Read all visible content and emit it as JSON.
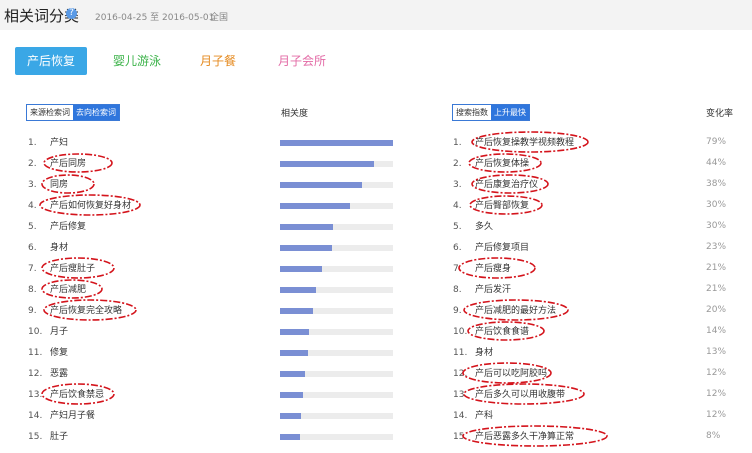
{
  "header": {
    "title": "相关词分类",
    "date_range": "2016-04-25 至 2016-05-01",
    "scope": "全国"
  },
  "tabs": [
    {
      "label": "产后恢复",
      "active": true
    },
    {
      "label": "婴儿游泳",
      "color": "#3cb34a"
    },
    {
      "label": "月子餐",
      "color": "#e58a1f"
    },
    {
      "label": "月子会所",
      "color": "#e36ba6"
    }
  ],
  "left_panel": {
    "toggle": [
      "来源检索词",
      "去向检索词"
    ],
    "relevance_header": "相关度",
    "rows": [
      {
        "n": "1.",
        "term": "产妇",
        "score": 1.0
      },
      {
        "n": "2.",
        "term": "产后同房",
        "score": 0.83
      },
      {
        "n": "3.",
        "term": "同房",
        "score": 0.73
      },
      {
        "n": "4.",
        "term": "产后如何恢复好身材",
        "score": 0.62
      },
      {
        "n": "5.",
        "term": "产后修复",
        "score": 0.47
      },
      {
        "n": "6.",
        "term": "身材",
        "score": 0.46
      },
      {
        "n": "7.",
        "term": "产后瘦肚子",
        "score": 0.37
      },
      {
        "n": "8.",
        "term": "产后减肥",
        "score": 0.32
      },
      {
        "n": "9.",
        "term": "产后恢复完全攻略",
        "score": 0.29
      },
      {
        "n": "10.",
        "term": "月子",
        "score": 0.26
      },
      {
        "n": "11.",
        "term": "修复",
        "score": 0.25
      },
      {
        "n": "12.",
        "term": "恶露",
        "score": 0.22
      },
      {
        "n": "13.",
        "term": "产后饮食禁忌",
        "score": 0.2
      },
      {
        "n": "14.",
        "term": "产妇月子餐",
        "score": 0.19
      },
      {
        "n": "15.",
        "term": "肚子",
        "score": 0.18
      }
    ]
  },
  "right_panel": {
    "toggle": [
      "搜索指数",
      "上升最快"
    ],
    "change_header": "变化率",
    "rows": [
      {
        "n": "1.",
        "term": "产后恢复操教学视频教程",
        "change": "79%"
      },
      {
        "n": "2.",
        "term": "产后恢复体操",
        "change": "44%"
      },
      {
        "n": "3.",
        "term": "产后康复治疗仪",
        "change": "38%"
      },
      {
        "n": "4.",
        "term": "产后臀部恢复",
        "change": "30%"
      },
      {
        "n": "5.",
        "term": "多久",
        "change": "30%"
      },
      {
        "n": "6.",
        "term": "产后修复项目",
        "change": "23%"
      },
      {
        "n": "7.",
        "term": "产后瘦身",
        "change": "21%"
      },
      {
        "n": "8.",
        "term": "产后发汗",
        "change": "21%"
      },
      {
        "n": "9.",
        "term": "产后减肥的最好方法",
        "change": "20%"
      },
      {
        "n": "10.",
        "term": "产后饮食食谱",
        "change": "14%"
      },
      {
        "n": "11.",
        "term": "身材",
        "change": "13%"
      },
      {
        "n": "12.",
        "term": "产后可以吃阿胶吗",
        "change": "12%"
      },
      {
        "n": "13.",
        "term": "产后多久可以用收腹带",
        "change": "12%"
      },
      {
        "n": "14.",
        "term": "产科",
        "change": "12%"
      },
      {
        "n": "15.",
        "term": "产后恶露多久干净算正常",
        "change": "8%"
      }
    ]
  },
  "colors": {
    "accent": "#3aa7e6",
    "bar": "#7a8fd4",
    "annotation": "#d4141c"
  }
}
